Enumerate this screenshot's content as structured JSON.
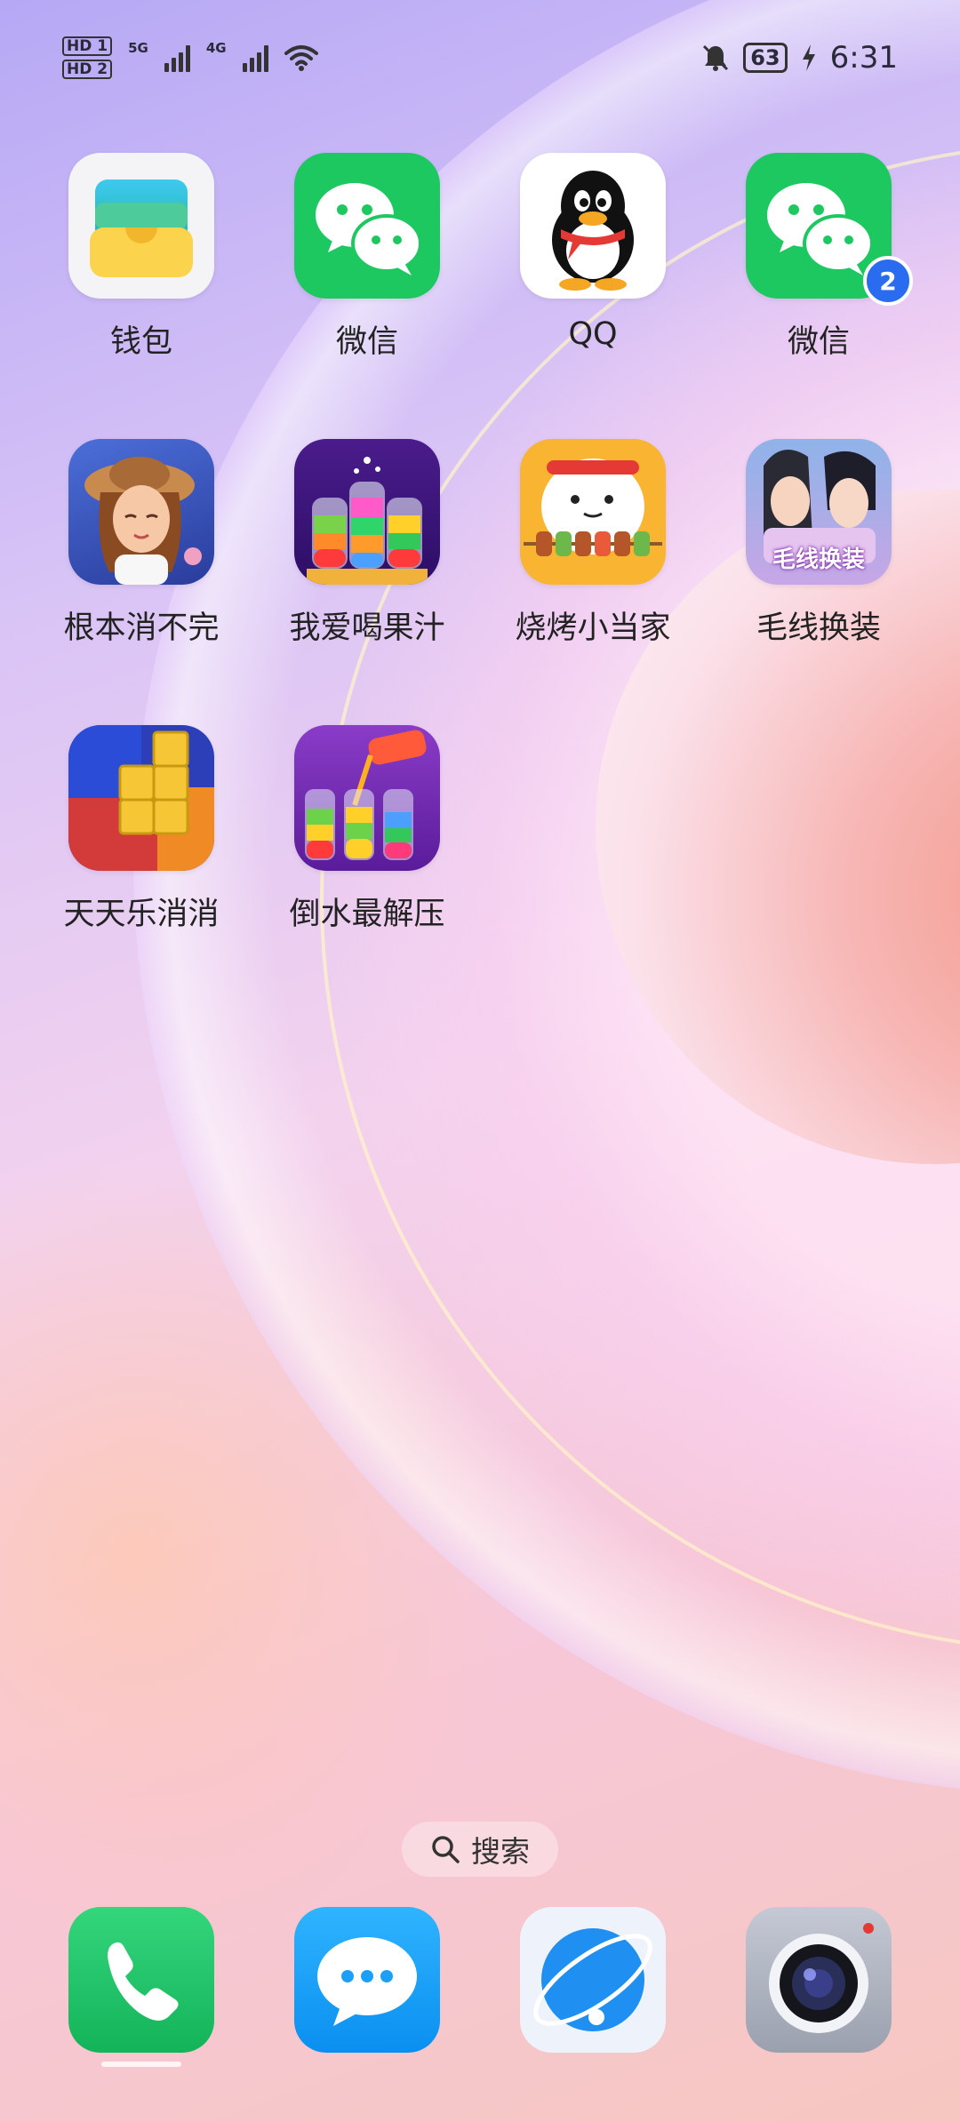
{
  "status_bar": {
    "sim1": "HD 1",
    "sim2": "HD 2",
    "net1": "5G",
    "net2": "4G",
    "battery": "63",
    "time": "6:31"
  },
  "apps": [
    {
      "label": "钱包",
      "icon": "wallet-icon"
    },
    {
      "label": "微信",
      "icon": "wechat-icon"
    },
    {
      "label": "QQ",
      "icon": "qq-penguin-icon"
    },
    {
      "label": "微信",
      "icon": "wechat-icon",
      "badge": "2"
    },
    {
      "label": "根本消不完",
      "icon": "game-girl-icon"
    },
    {
      "label": "我爱喝果汁",
      "icon": "juice-bottles-icon"
    },
    {
      "label": "烧烤小当家",
      "icon": "bbq-icon"
    },
    {
      "label": "毛线换装",
      "icon": "dressup-couple-icon",
      "icon_text": "毛线换装"
    },
    {
      "label": "天天乐消消",
      "icon": "block-puzzle-icon"
    },
    {
      "label": "倒水最解压",
      "icon": "pour-water-icon"
    }
  ],
  "search": {
    "label": "搜索",
    "icon": "search-icon"
  },
  "dock": [
    {
      "name": "phone",
      "icon": "phone-icon"
    },
    {
      "name": "messages",
      "icon": "message-icon"
    },
    {
      "name": "browser",
      "icon": "browser-icon"
    },
    {
      "name": "camera",
      "icon": "camera-icon"
    }
  ],
  "colors": {
    "wechat_green": "#1ec860",
    "badge_blue": "#2a6cf0",
    "phone_green": "#20c26a",
    "messages_blue": "#1ca0f7"
  }
}
